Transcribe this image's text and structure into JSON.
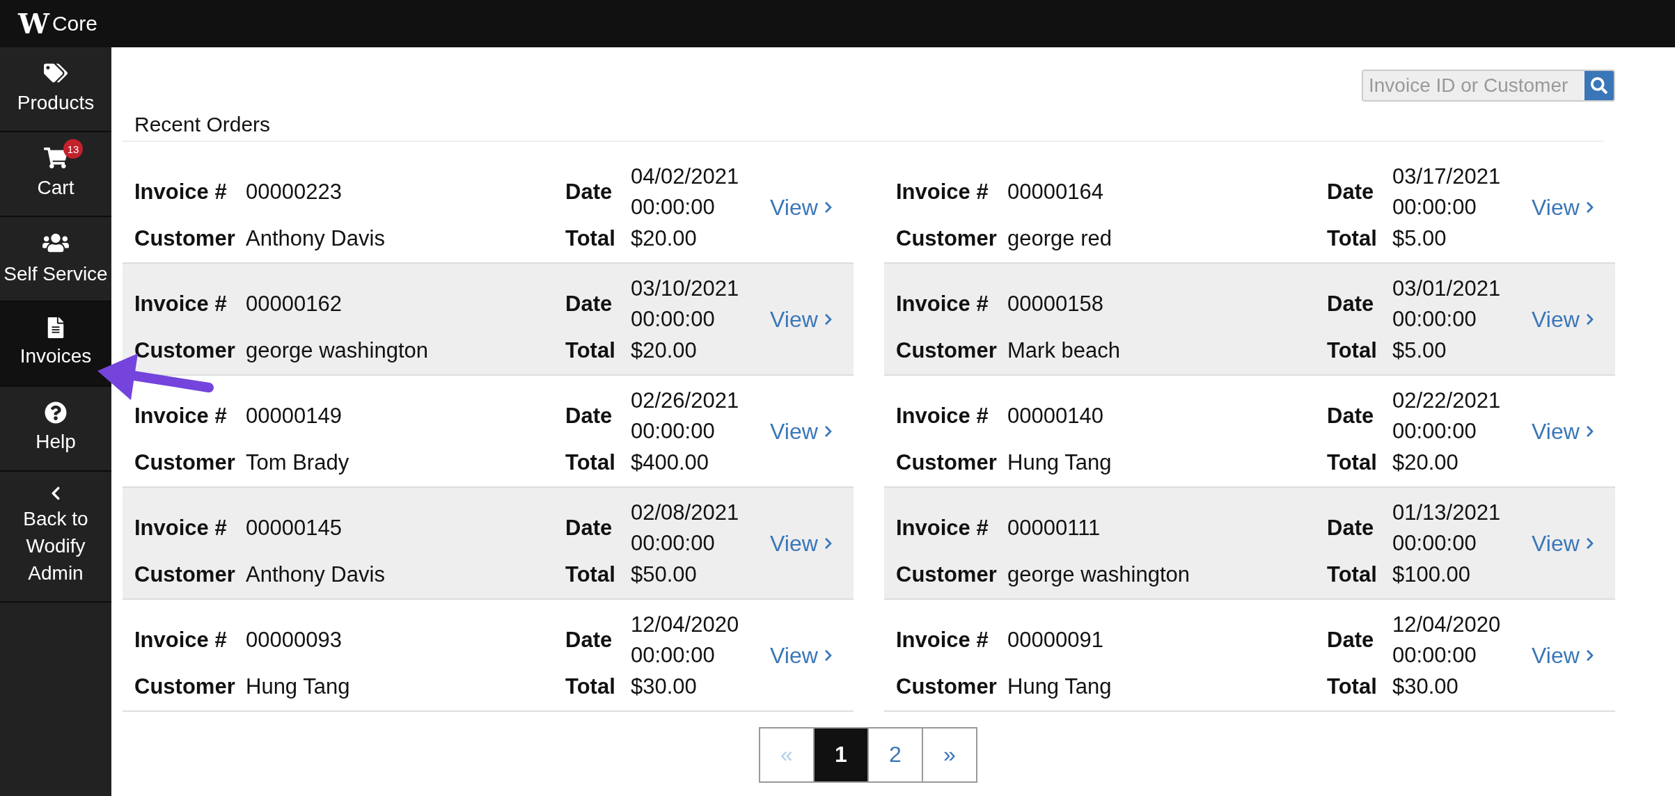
{
  "header": {
    "logo_mark": "W",
    "app_name": "Core"
  },
  "sidebar": {
    "items": [
      {
        "kind": "tags",
        "label": "Products",
        "selected": false
      },
      {
        "kind": "cart",
        "label": "Cart",
        "badge": "13",
        "selected": false
      },
      {
        "kind": "people",
        "label": "Self Service",
        "selected": false
      },
      {
        "kind": "document",
        "label": "Invoices",
        "selected": true
      },
      {
        "kind": "help",
        "label": "Help",
        "selected": false
      },
      {
        "kind": "back",
        "label": "Back to Wodify Admin",
        "selected": false
      }
    ]
  },
  "search": {
    "placeholder": "Invoice ID or Customer"
  },
  "section_title": "Recent Orders",
  "orders": [
    {
      "invoice_label": "Invoice #",
      "invoice": "00000223",
      "customer_label": "Customer",
      "customer": "Anthony Davis",
      "date_label": "Date",
      "date": "04/02/2021 00:00:00",
      "total_label": "Total",
      "total": "$20.00",
      "link": "View"
    },
    {
      "invoice_label": "Invoice #",
      "invoice": "00000164",
      "customer_label": "Customer",
      "customer": "george red",
      "date_label": "Date",
      "date": "03/17/2021 00:00:00",
      "total_label": "Total",
      "total": "$5.00",
      "link": "View"
    },
    {
      "invoice_label": "Invoice #",
      "invoice": "00000162",
      "customer_label": "Customer",
      "customer": "george washington",
      "date_label": "Date",
      "date": "03/10/2021 00:00:00",
      "total_label": "Total",
      "total": "$20.00",
      "link": "View"
    },
    {
      "invoice_label": "Invoice #",
      "invoice": "00000158",
      "customer_label": "Customer",
      "customer": "Mark beach",
      "date_label": "Date",
      "date": "03/01/2021 00:00:00",
      "total_label": "Total",
      "total": "$5.00",
      "link": "View"
    },
    {
      "invoice_label": "Invoice #",
      "invoice": "00000149",
      "customer_label": "Customer",
      "customer": "Tom Brady",
      "date_label": "Date",
      "date": "02/26/2021 00:00:00",
      "total_label": "Total",
      "total": "$400.00",
      "link": "View"
    },
    {
      "invoice_label": "Invoice #",
      "invoice": "00000140",
      "customer_label": "Customer",
      "customer": "Hung Tang",
      "date_label": "Date",
      "date": "02/22/2021 00:00:00",
      "total_label": "Total",
      "total": "$20.00",
      "link": "View"
    },
    {
      "invoice_label": "Invoice #",
      "invoice": "00000145",
      "customer_label": "Customer",
      "customer": "Anthony Davis",
      "date_label": "Date",
      "date": "02/08/2021 00:00:00",
      "total_label": "Total",
      "total": "$50.00",
      "link": "View"
    },
    {
      "invoice_label": "Invoice #",
      "invoice": "00000111",
      "customer_label": "Customer",
      "customer": "george washington",
      "date_label": "Date",
      "date": "01/13/2021 00:00:00",
      "total_label": "Total",
      "total": "$100.00",
      "link": "View"
    },
    {
      "invoice_label": "Invoice #",
      "invoice": "00000093",
      "customer_label": "Customer",
      "customer": "Hung Tang",
      "date_label": "Date",
      "date": "12/04/2020 00:00:00",
      "total_label": "Total",
      "total": "$30.00",
      "link": "View"
    },
    {
      "invoice_label": "Invoice #",
      "invoice": "00000091",
      "customer_label": "Customer",
      "customer": "Hung Tang",
      "date_label": "Date",
      "date": "12/04/2020 00:00:00",
      "total_label": "Total",
      "total": "$30.00",
      "link": "View"
    }
  ],
  "pagination": [
    {
      "label": "«",
      "selected": false,
      "disabled": true
    },
    {
      "label": "1",
      "selected": true,
      "disabled": false
    },
    {
      "label": "2",
      "selected": false,
      "disabled": false
    },
    {
      "label": "»",
      "selected": false,
      "disabled": false
    }
  ],
  "annotation": {
    "kind": "arrow"
  }
}
